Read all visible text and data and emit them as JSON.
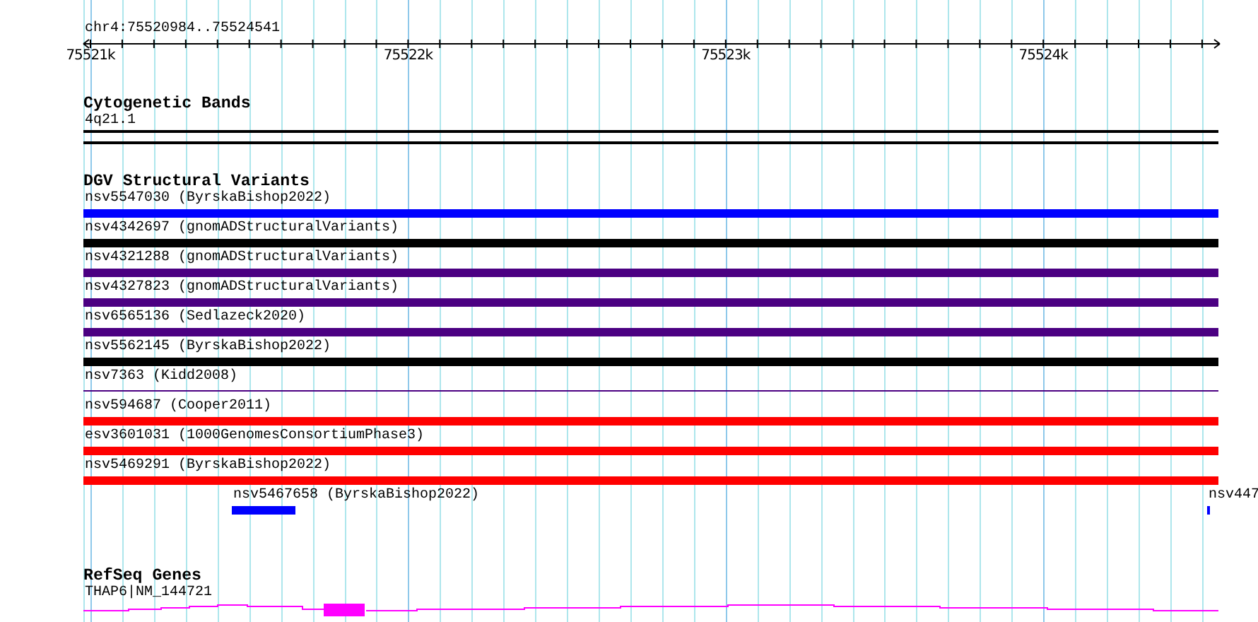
{
  "ruler": {
    "location": "chr4:75520984..75524541",
    "ticks": [
      "75521k",
      "75522k",
      "75523k",
      "75524k"
    ]
  },
  "cytogenetic_bands": {
    "title": "Cytogenetic Bands",
    "bands": [
      {
        "label": "4q21.1"
      }
    ]
  },
  "dgv_structural_variants": {
    "title": "DGV Structural Variants",
    "rows": [
      {
        "label": "nsv5547030 (ByrskaBishop2022)",
        "color": "#0000ff",
        "kind": "thick"
      },
      {
        "label": "nsv4342697 (gnomADStructuralVariants)",
        "color": "#000000",
        "kind": "thick"
      },
      {
        "label": "nsv4321288 (gnomADStructuralVariants)",
        "color": "#4b0082",
        "kind": "thick"
      },
      {
        "label": "nsv4327823 (gnomADStructuralVariants)",
        "color": "#4b0082",
        "kind": "thick"
      },
      {
        "label": "nsv6565136 (Sedlazeck2020)",
        "color": "#4b0082",
        "kind": "thick"
      },
      {
        "label": "nsv5562145 (ByrskaBishop2022)",
        "color": "#000000",
        "kind": "thick"
      },
      {
        "label": "nsv7363 (Kidd2008)",
        "color": "#4b0082",
        "kind": "thin"
      },
      {
        "label": "nsv594687 (Cooper2011)",
        "color": "#ff0000",
        "kind": "thick"
      },
      {
        "label": "esv3601031 (1000GenomesConsortiumPhase3)",
        "color": "#ff0000",
        "kind": "thick"
      },
      {
        "label": "nsv5469291 (ByrskaBishop2022)",
        "color": "#ff0000",
        "kind": "thick"
      }
    ],
    "partial_row": [
      {
        "label": "nsv5467658 (ByrskaBishop2022)",
        "color": "#0000ff"
      },
      {
        "label": "nsv447",
        "color": "#0000ff"
      }
    ]
  },
  "refseq_genes": {
    "title": "RefSeq Genes",
    "genes": [
      {
        "label": "THAP6|NM_144721"
      }
    ]
  }
}
